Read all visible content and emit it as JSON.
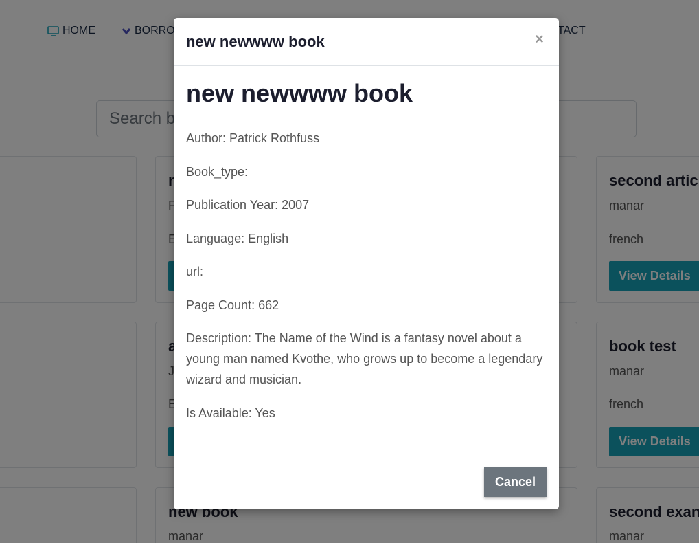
{
  "nav": {
    "home_label": "HOME",
    "borrow_label": "BORRO",
    "contact_label": "TACT"
  },
  "search": {
    "placeholder": "Search bo"
  },
  "cards": [
    {
      "title": "n",
      "author": "F",
      "lang": "E",
      "button": ""
    },
    {
      "title": "second artic",
      "author": "manar",
      "lang": "french",
      "button": "View Details"
    },
    {
      "title": "a",
      "author": "J",
      "lang": "E",
      "button": ""
    },
    {
      "title": "book test",
      "author": "manar",
      "lang": "french",
      "button": "View Details"
    },
    {
      "title": "new book",
      "author": "manar"
    },
    {
      "title": "second exan",
      "author": "manar"
    }
  ],
  "modal": {
    "title": "new newwww book",
    "close_label": "×",
    "heading": "new newwww book",
    "fields": [
      "Author: Patrick Rothfuss",
      "Book_type:",
      "Publication Year: 2007",
      "Language: English",
      "url:",
      "Page Count: 662",
      "Description: The Name of the Wind is a fantasy novel about a young man named Kvothe, who grows up to become a legendary wizard and musician.",
      "Is Available: Yes"
    ],
    "cancel_label": "Cancel"
  },
  "colors": {
    "accent": "#17a2b8",
    "secondary": "#6c757d",
    "icon_home": "#17a2b8",
    "icon_borrow": "#4a4fbf"
  },
  "icons": {
    "home": "monitor-icon",
    "borrow": "chevron-down-icon",
    "close": "close-icon"
  }
}
